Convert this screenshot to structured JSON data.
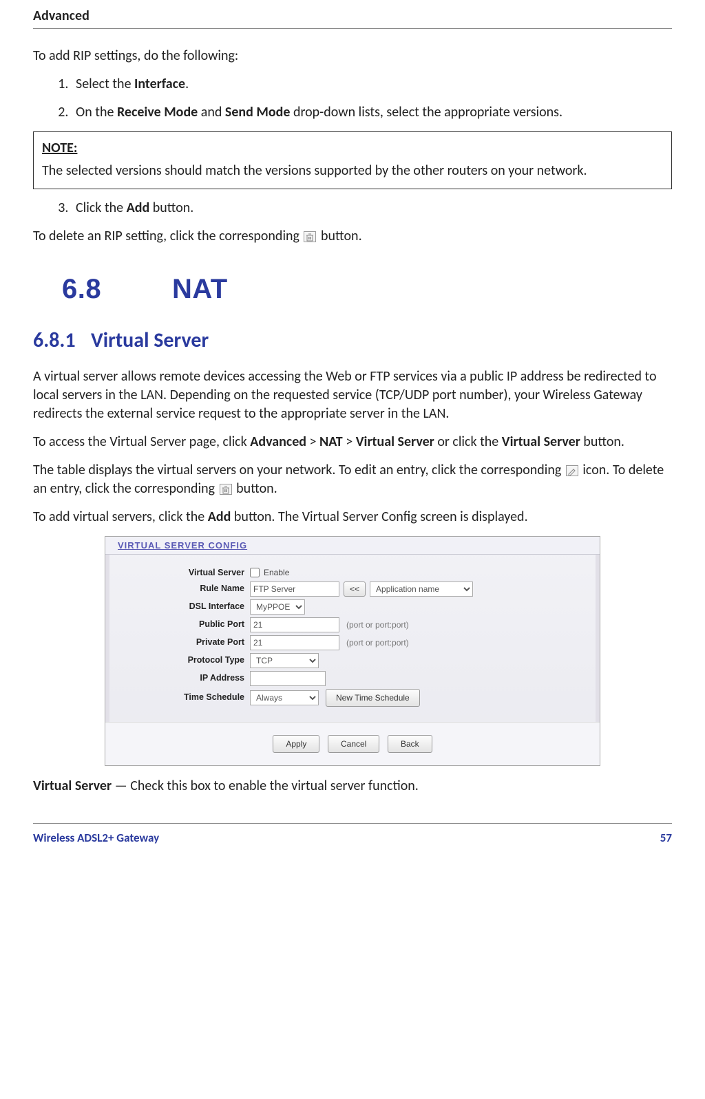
{
  "header": {
    "text": "Advanced"
  },
  "intro": "To add RIP settings, do the following:",
  "steps": {
    "s1a": "Select the ",
    "s1b": "Interface",
    "s1c": ".",
    "s2a": "On the ",
    "s2b": "Receive Mode",
    "s2c": " and ",
    "s2d": "Send Mode",
    "s2e": " drop-down lists, select the appropriate versions.",
    "s3a": "Click the ",
    "s3b": "Add",
    "s3c": " button."
  },
  "note": {
    "label": "NOTE:",
    "text": "The selected versions should match the versions supported by the other routers on your network."
  },
  "delete_rip_a": "To delete an RIP setting, click the corresponding ",
  "delete_rip_b": " button.",
  "section_major": {
    "num": "6.8",
    "title": "NAT"
  },
  "section_minor": {
    "num": "6.8.1",
    "title": "Virtual Server"
  },
  "vs_para1": "A virtual server allows remote devices accessing the Web or FTP services via a public IP address be redirected to local servers in the LAN. Depending on the requested service (TCP/UDP port number), your Wireless Gateway redirects the external service request to the appropriate server in the LAN.",
  "vs_access_a": "To access the Virtual Server page, click ",
  "vs_access_b": "Advanced",
  "vs_access_c": " > ",
  "vs_access_d": "NAT",
  "vs_access_e": " > ",
  "vs_access_f": "Virtual Server",
  "vs_access_g": " or click the ",
  "vs_access_h": "Virtual Server",
  "vs_access_i": " button.",
  "vs_table_a": "The table displays the virtual servers on your network. To edit an entry, click the corresponding ",
  "vs_table_b": " icon. To delete an entry, click the corresponding ",
  "vs_table_c": " button.",
  "vs_add_a": "To add virtual servers, click the ",
  "vs_add_b": "Add",
  "vs_add_c": " button. The Virtual Server Config screen is displayed.",
  "screenshot": {
    "title": "VIRTUAL SERVER CONFIG",
    "rows": {
      "virtual_server": {
        "label": "Virtual Server",
        "value": "Enable"
      },
      "rule_name": {
        "label": "Rule Name",
        "value": "FTP Server",
        "btn": "<<",
        "app": "Application name"
      },
      "dsl_if": {
        "label": "DSL Interface",
        "value": "MyPPOE"
      },
      "pub_port": {
        "label": "Public Port",
        "value": "21",
        "hint": "(port or port:port)"
      },
      "priv_port": {
        "label": "Private Port",
        "value": "21",
        "hint": "(port or port:port)"
      },
      "proto": {
        "label": "Protocol Type",
        "value": "TCP"
      },
      "ip": {
        "label": "IP Address",
        "value": ""
      },
      "sched": {
        "label": "Time Schedule",
        "value": "Always",
        "btn": "New Time Schedule"
      }
    },
    "buttons": {
      "apply": "Apply",
      "cancel": "Cancel",
      "back": "Back"
    }
  },
  "vs_enable_a": "Virtual Server",
  "vs_enable_b": " — Check this box to enable the virtual server function.",
  "footer": {
    "left": "Wireless ADSL2+ Gateway",
    "right": "57"
  }
}
